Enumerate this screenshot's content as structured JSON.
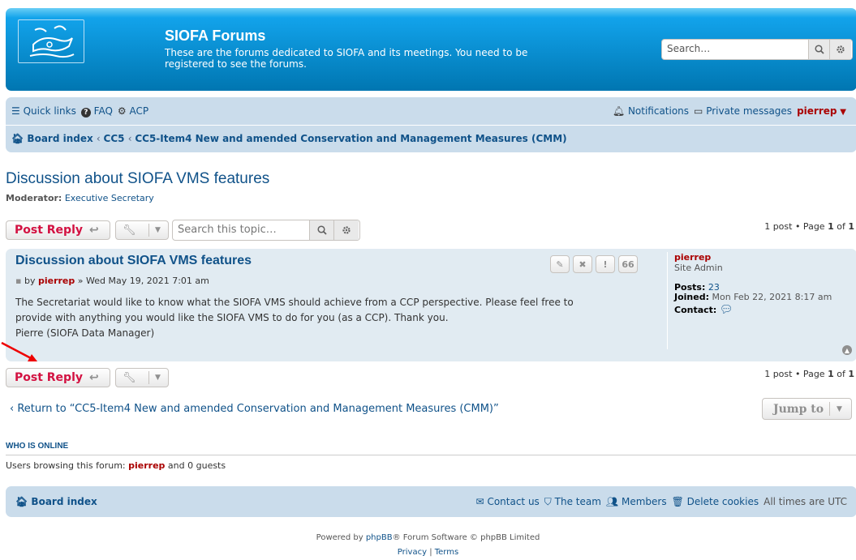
{
  "header": {
    "site_title": "SIOFA Forums",
    "site_description": "These are the forums dedicated to SIOFA and its meetings. You need to be registered to see the forums.",
    "search_placeholder": "Search…",
    "colors": {
      "header_bg": "#12a3eb",
      "nav_bg": "#cadceb",
      "post_bg": "#e1ebf2",
      "accent": "#d31141",
      "username": "#aa0000"
    }
  },
  "nav": {
    "quick_links": "Quick links",
    "faq": "FAQ",
    "acp": "ACP",
    "notifications": "Notifications",
    "private_messages": "Private messages",
    "username": "pierrep",
    "breadcrumbs": [
      "Board index",
      "CC5",
      "CC5-Item4 New and amended Conservation and Management Measures (CMM)"
    ]
  },
  "topic": {
    "title": "Discussion about SIOFA VMS features",
    "moderator_label": "Moderator:",
    "moderator_name": "Executive Secretary",
    "post_reply": "Post Reply",
    "search_placeholder": "Search this topic…",
    "pagination_prefix": "1 post • Page",
    "page_current": "1",
    "page_of": "of",
    "page_total": "1"
  },
  "post": {
    "title": "Discussion about SIOFA VMS features",
    "by": "by",
    "author": "pierrep",
    "date": "» Wed May 19, 2021 7:01 am",
    "content_lines": [
      "The Secretariat would like to know what the SIOFA VMS should achieve from a CCP perspective. Please feel free to",
      "provide with anything you would like the SIOFA VMS to do for you (as a CCP). Thank you.",
      "Pierre (SIOFA Data Manager)"
    ],
    "buttons": [
      "✎",
      "✖",
      "!",
      "66"
    ],
    "profile": {
      "name": "pierrep",
      "rank": "Site Admin",
      "posts_label": "Posts:",
      "posts_value": "23",
      "joined_label": "Joined:",
      "joined_value": "Mon Feb 22, 2021 8:17 am",
      "contact_label": "Contact:"
    }
  },
  "bottom": {
    "return_text": "Return to “CC5-Item4 New and amended Conservation and Management Measures (CMM)”",
    "jump_to": "Jump to"
  },
  "online": {
    "title": "WHO IS ONLINE",
    "prefix": "Users browsing this forum:",
    "user": "pierrep",
    "suffix": "and 0 guests"
  },
  "footer": {
    "board_index": "Board index",
    "contact_us": "Contact us",
    "the_team": "The team",
    "members": "Members",
    "delete_cookies": "Delete cookies",
    "timezone": "All times are UTC",
    "powered_prefix": "Powered by",
    "phpbb": "phpBB",
    "powered_suffix": "® Forum Software © phpBB Limited",
    "privacy": "Privacy",
    "terms": "Terms"
  }
}
